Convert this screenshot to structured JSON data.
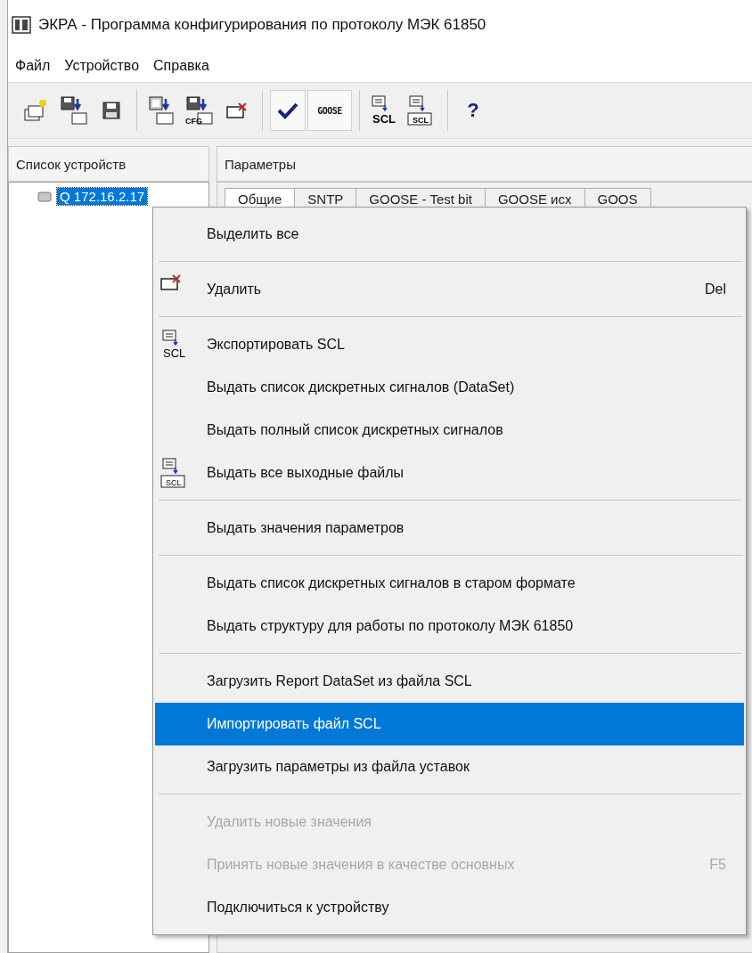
{
  "window": {
    "title": "ЭКРА - Программа конфигурирования по протоколу МЭК 61850"
  },
  "menu_bar": [
    {
      "label": "Файл"
    },
    {
      "label": "Устройство"
    },
    {
      "label": "Справка"
    }
  ],
  "toolbar": [
    [
      {
        "kind": "new",
        "pressed": false
      },
      {
        "kind": "save-to",
        "pressed": false
      },
      {
        "kind": "save",
        "pressed": false
      }
    ],
    [
      {
        "kind": "read",
        "pressed": false
      },
      {
        "kind": "save-cfg",
        "pressed": false,
        "caption": "CFG"
      },
      {
        "kind": "delete",
        "pressed": false
      }
    ],
    [
      {
        "kind": "check",
        "pressed": true
      },
      {
        "kind": "goose",
        "pressed": true,
        "caption": "GOOSE"
      }
    ],
    [
      {
        "kind": "export",
        "pressed": false,
        "caption": "SCL"
      },
      {
        "kind": "export-all",
        "pressed": false,
        "caption": "SCL"
      }
    ],
    [
      {
        "kind": "help",
        "pressed": false,
        "caption": "?"
      }
    ]
  ],
  "panels": {
    "devices": "Список устройств",
    "parameters": "Параметры"
  },
  "tree": [
    {
      "label": "Q 172.16.2.17",
      "selected": true
    }
  ],
  "tabs": [
    {
      "label": "Общие",
      "selected": true
    },
    {
      "label": "SNTP",
      "selected": false
    },
    {
      "label": "GOOSE - Test bit",
      "selected": false
    },
    {
      "label": "GOOSE исх",
      "selected": false
    },
    {
      "label": "GOOS",
      "selected": false
    }
  ],
  "context_menu": [
    [
      {
        "kind": "plain",
        "label": "Выделить все",
        "disabled": false,
        "selected": false
      }
    ],
    [
      {
        "kind": "delete",
        "label": "Удалить",
        "shortcut": "Del",
        "disabled": false,
        "selected": false
      }
    ],
    [
      {
        "kind": "export",
        "label": "Экспортировать SCL",
        "icon_caption": "SCL",
        "disabled": false,
        "selected": false
      },
      {
        "kind": "plain",
        "label": "Выдать список дискретных сигналов (DataSet)",
        "disabled": false,
        "selected": false
      },
      {
        "kind": "plain",
        "label": "Выдать полный список дискретных сигналов",
        "disabled": false,
        "selected": false
      },
      {
        "kind": "export-all",
        "label": "Выдать все выходные файлы",
        "icon_caption": "SCL",
        "disabled": false,
        "selected": false
      }
    ],
    [
      {
        "kind": "plain",
        "label": "Выдать значения параметров",
        "disabled": false,
        "selected": false
      }
    ],
    [
      {
        "kind": "plain",
        "label": "Выдать список дискретных сигналов в старом формате",
        "disabled": false,
        "selected": false
      },
      {
        "kind": "plain",
        "label": "Выдать структуру для работы по протоколу МЭК 61850",
        "disabled": false,
        "selected": false
      }
    ],
    [
      {
        "kind": "plain",
        "label": "Загрузить Report DataSet из файла SCL",
        "disabled": false,
        "selected": false
      },
      {
        "kind": "plain",
        "label": "Импортировать файл SCL",
        "disabled": false,
        "selected": true
      },
      {
        "kind": "plain",
        "label": "Загрузить параметры из файла уставок",
        "disabled": false,
        "selected": false
      }
    ],
    [
      {
        "kind": "plain",
        "label": "Удалить новые значения",
        "disabled": true,
        "selected": false
      },
      {
        "kind": "plain",
        "label": "Принять новые значения в качестве основных",
        "shortcut": "F5",
        "disabled": true,
        "selected": false
      },
      {
        "kind": "plain",
        "label": "Подключиться к устройству",
        "disabled": false,
        "selected": false
      }
    ]
  ]
}
